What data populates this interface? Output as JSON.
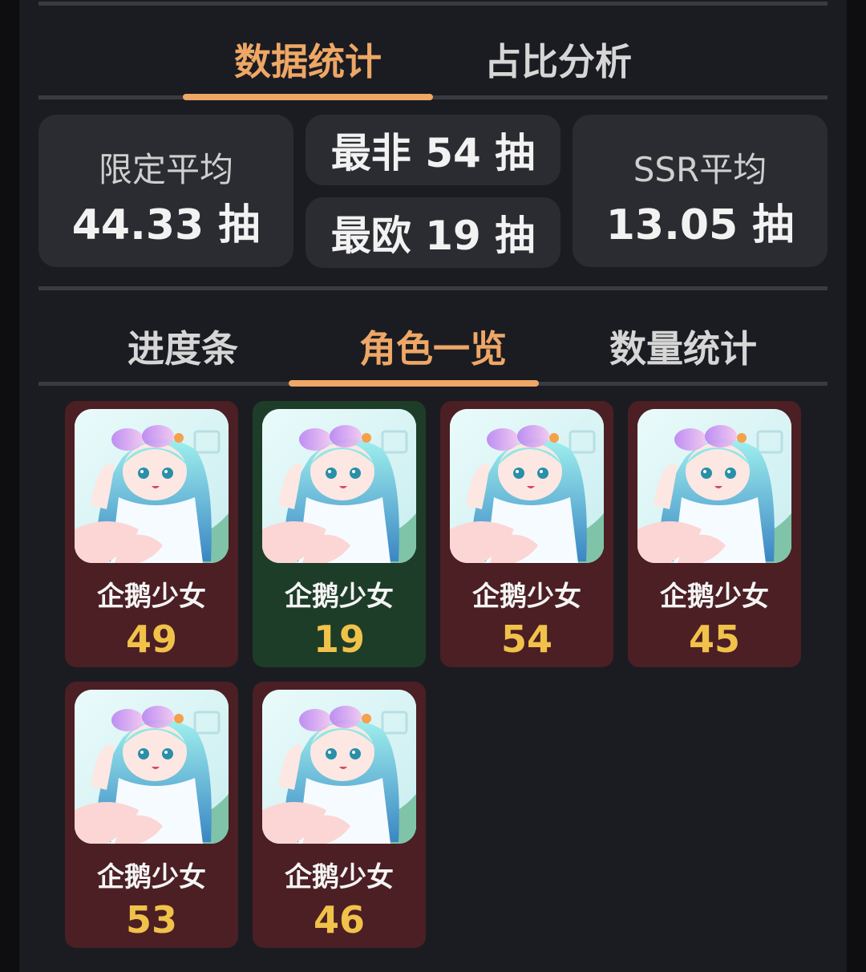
{
  "top_tabs": [
    "数据统计",
    "占比分析"
  ],
  "stats": {
    "limited_avg_label": "限定平均",
    "limited_avg_value": "44.33 抽",
    "worst_value": "最非 54 抽",
    "best_value": "最欧 19 抽",
    "ssr_avg_label": "SSR平均",
    "ssr_avg_value": "13.05 抽"
  },
  "sub_tabs": [
    "进度条",
    "角色一览",
    "数量统计"
  ],
  "characters": [
    {
      "name": "企鹅少女",
      "count": "49"
    },
    {
      "name": "企鹅少女",
      "count": "19"
    },
    {
      "name": "企鹅少女",
      "count": "54"
    },
    {
      "name": "企鹅少女",
      "count": "45"
    },
    {
      "name": "企鹅少女",
      "count": "53"
    },
    {
      "name": "企鹅少女",
      "count": "46"
    }
  ],
  "colors": {
    "accent": "#eea766",
    "card_red": "#4b1f24",
    "card_green": "#1e3d28",
    "count_gold": "#f1c24a"
  }
}
